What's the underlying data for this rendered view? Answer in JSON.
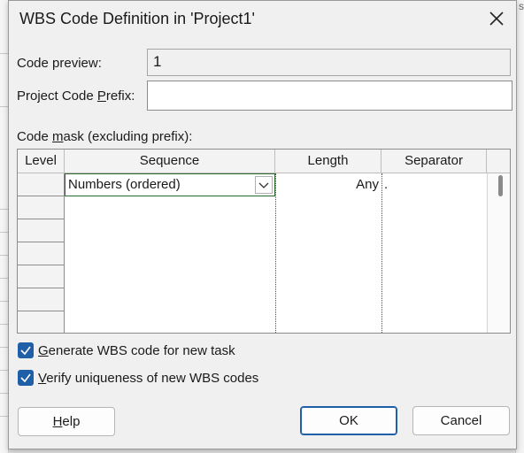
{
  "background": {
    "right_edge_char": "s"
  },
  "dialog": {
    "title": "WBS Code Definition in 'Project1'",
    "code_preview": {
      "label": "Code preview:",
      "value": "1"
    },
    "prefix": {
      "label_pre": "Project Code ",
      "label_key": "P",
      "label_post": "refix:",
      "value": ""
    },
    "mask": {
      "label_pre": "Code ",
      "label_key": "m",
      "label_post": "ask (excluding prefix):",
      "columns": [
        "Level",
        "Sequence",
        "Length",
        "Separator"
      ],
      "rows": [
        {
          "level": "",
          "sequence": "Numbers (ordered)",
          "length": "Any",
          "separator": "."
        }
      ]
    },
    "checkboxes": [
      {
        "key": "G",
        "rest": "enerate WBS code for new task",
        "checked": true
      },
      {
        "key": "V",
        "rest": "erify uniqueness of new WBS codes",
        "checked": true
      }
    ],
    "buttons": {
      "help_key": "H",
      "help_rest": "elp",
      "ok": "OK",
      "cancel": "Cancel"
    }
  },
  "colors": {
    "accent": "#1f5fa8",
    "active_cell_border": "#2e6b2e"
  }
}
